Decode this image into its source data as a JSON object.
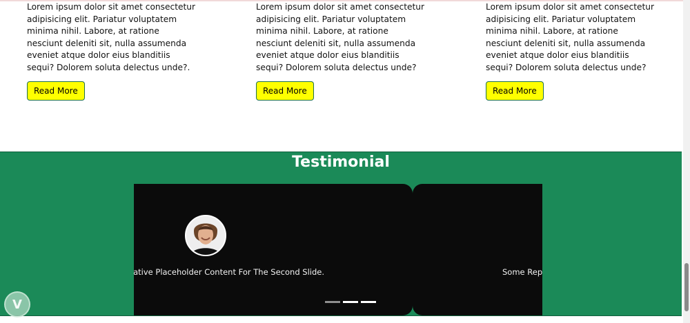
{
  "cards": [
    {
      "text": "Lorem ipsum dolor sit amet consectetur adipisicing elit. Pariatur voluptatem minima nihil. Labore, at ratione nesciunt deleniti sit, nulla assumenda eveniet atque dolor eius blanditiis sequi? Dolorem soluta delectus unde?.",
      "button": "Read More"
    },
    {
      "text": "Lorem ipsum dolor sit amet consectetur adipisicing elit. Pariatur voluptatem minima nihil. Labore, at ratione nesciunt deleniti sit, nulla assumenda eveniet atque dolor eius blanditiis sequi? Dolorem soluta delectus unde?",
      "button": "Read More"
    },
    {
      "text": "Lorem ipsum dolor sit amet consectetur adipisicing elit. Pariatur voluptatem minima nihil. Labore, at ratione nesciunt deleniti sit, nulla assumenda eveniet atque dolor eius blanditiis sequi? Dolorem soluta delectus unde?",
      "button": "Read More"
    }
  ],
  "testimonial": {
    "title": "Testimonial",
    "slides": [
      {
        "caption": "esentative Placeholder Content For The Second Slide."
      },
      {
        "caption": "Some Rep"
      }
    ],
    "indicators": 3,
    "active_indicator": 3
  },
  "colors": {
    "accent_button": "#ffff00",
    "section_bg": "#1b8a58",
    "slide_bg": "#0b0b0b"
  },
  "icons": {
    "avatar": "person-avatar",
    "logo": "v-logo-icon"
  }
}
